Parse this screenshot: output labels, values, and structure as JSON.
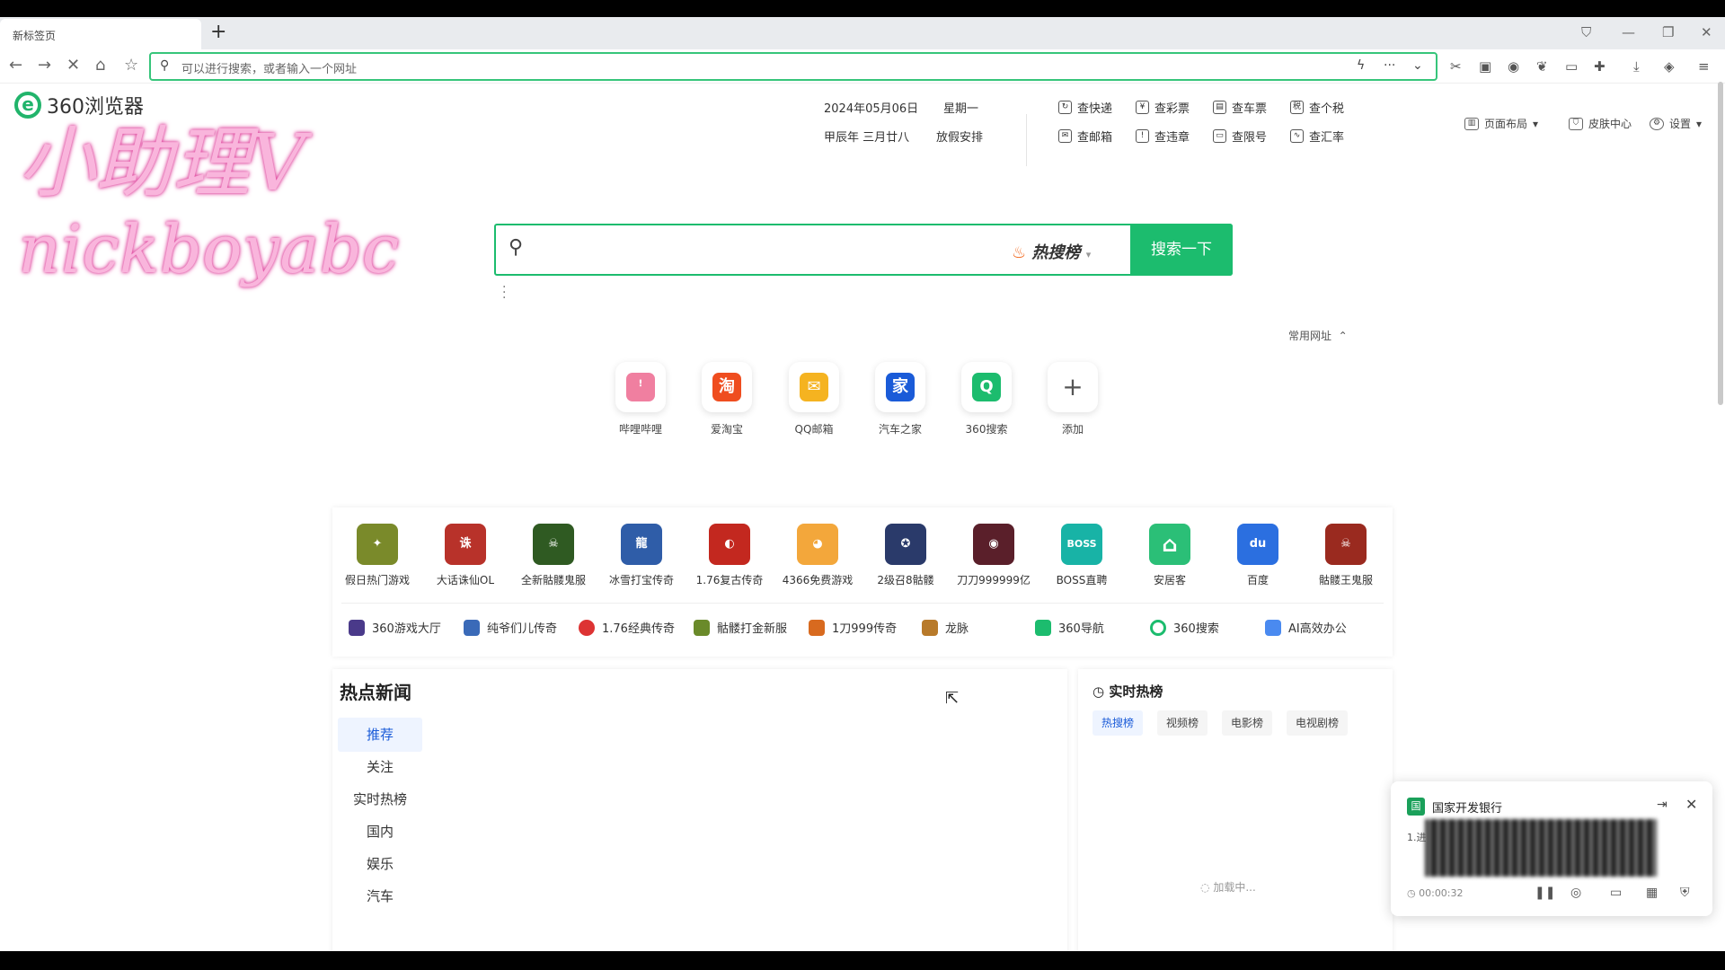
{
  "tab": {
    "title": "新标签页"
  },
  "address_bar": {
    "placeholder": "可以进行搜索，或者输入一个网址"
  },
  "logo": {
    "text": "360浏览器"
  },
  "watermark": {
    "line1": "小助理V",
    "line2": "nickboyabc"
  },
  "date": {
    "gregorian": "2024年05月06日",
    "weekday": "星期一",
    "lunar": "甲辰年 三月廿八",
    "holiday": "放假安排"
  },
  "services": [
    "查快递",
    "查彩票",
    "查车票",
    "查个税",
    "查邮箱",
    "查违章",
    "查限号",
    "查汇率"
  ],
  "header_right": [
    "页面布局",
    "皮肤中心",
    "设置"
  ],
  "search": {
    "hot_label": "热搜榜",
    "button": "搜索一下"
  },
  "common_sites_label": "常用网址",
  "shortcuts": [
    {
      "label": "哔哩哔哩",
      "glyph": "ꜝ",
      "color": "#f07fa0"
    },
    {
      "label": "爱淘宝",
      "glyph": "淘",
      "color": "#ef4d1f"
    },
    {
      "label": "QQ邮箱",
      "glyph": "✉",
      "color": "#f5b320"
    },
    {
      "label": "汽车之家",
      "glyph": "家",
      "color": "#1a5bd8"
    },
    {
      "label": "360搜索",
      "glyph": "Q",
      "color": "#1cbc6e"
    },
    {
      "label": "添加",
      "glyph": "+",
      "color": "#ffffff"
    }
  ],
  "games": [
    {
      "label": "假日热门游戏",
      "color": "#7a8a2a",
      "glyph": "✦"
    },
    {
      "label": "大话诛仙OL",
      "color": "#b8322a",
      "glyph": "诛"
    },
    {
      "label": "全新骷髅鬼服",
      "color": "#2f5a22",
      "glyph": "☠"
    },
    {
      "label": "冰雪打宝传奇",
      "color": "#2f5da8",
      "glyph": "龍"
    },
    {
      "label": "1.76复古传奇",
      "color": "#c3281f",
      "glyph": "◐"
    },
    {
      "label": "4366免费游戏",
      "color": "#f3a73b",
      "glyph": "◕"
    },
    {
      "label": "2级召8骷髅",
      "color": "#2a3a6a",
      "glyph": "✪"
    },
    {
      "label": "刀刀999999亿",
      "color": "#5a1f2a",
      "glyph": "◉"
    },
    {
      "label": "BOSS直聘",
      "color": "#18b3a6",
      "glyph": "BOSS"
    },
    {
      "label": "安居客",
      "color": "#2bbf77",
      "glyph": "⌂"
    },
    {
      "label": "百度",
      "color": "#2b6fe0",
      "glyph": "du"
    },
    {
      "label": "骷髅王鬼服",
      "color": "#9a2a1f",
      "glyph": "☠"
    }
  ],
  "game_links": [
    {
      "label": "360游戏大厅",
      "color": "#4a3a8a"
    },
    {
      "label": "纯爷们儿传奇",
      "color": "#3a6ab8"
    },
    {
      "label": "1.76经典传奇",
      "color": "#d33"
    },
    {
      "label": "骷髅打金新服",
      "color": "#6a8a2a"
    },
    {
      "label": "1刀999传奇",
      "color": "#d86a1f"
    },
    {
      "label": "龙脉",
      "color": "#b87a2a"
    },
    {
      "label": "360导航",
      "color": "#1cbc6e"
    },
    {
      "label": "360搜索",
      "color": "#1cbc6e"
    },
    {
      "label": "AI高效办公",
      "color": "#4a8af0"
    }
  ],
  "news": {
    "title": "热点新闻",
    "categories": [
      "推荐",
      "关注",
      "实时热榜",
      "国内",
      "娱乐",
      "汽车"
    ]
  },
  "hot_panel": {
    "title": "实时热榜",
    "tabs": [
      "热搜榜",
      "视频榜",
      "电影榜",
      "电视剧榜"
    ],
    "loading": "加载中..."
  },
  "notification": {
    "bank": "国家开发银行",
    "badge": "国",
    "item_prefix": "1.进",
    "time": "00:00:32"
  },
  "colors": {
    "accent": "#1cbc6e",
    "link_blue": "#1a5bd8"
  }
}
